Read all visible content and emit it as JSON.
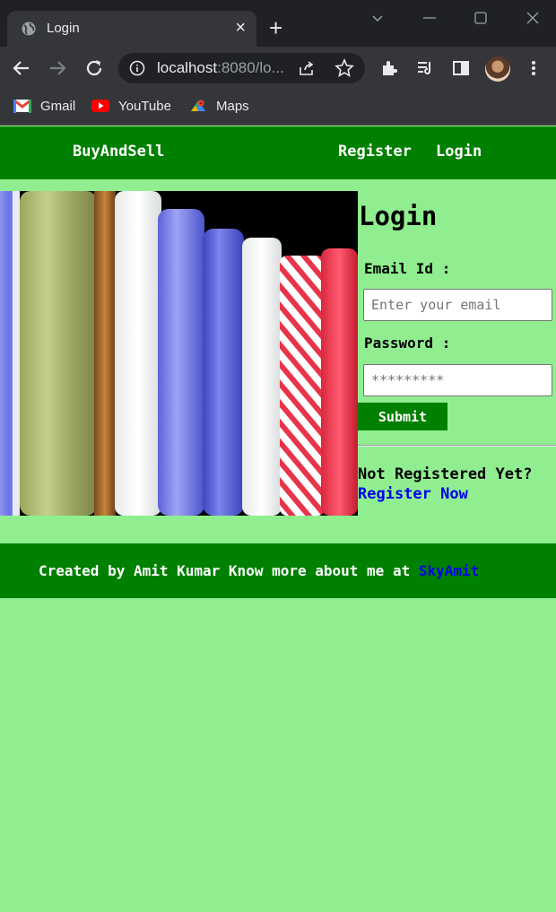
{
  "browser": {
    "tab_title": "Login",
    "tab_close": "×",
    "new_tab": "+",
    "url_host": "localhost",
    "url_rest": ":8080/lo...",
    "bookmarks": [
      {
        "label": "Gmail",
        "icon": "gmail-icon"
      },
      {
        "label": "YouTube",
        "icon": "youtube-icon"
      },
      {
        "label": "Maps",
        "icon": "maps-icon"
      }
    ]
  },
  "header": {
    "brand": "BuyAndSell",
    "nav": [
      "Register",
      "Login"
    ]
  },
  "login": {
    "title": "Login",
    "email_label": "Email Id :",
    "email_placeholder": "Enter your email",
    "password_label": "Password :",
    "password_placeholder": "*********",
    "submit_label": "Submit",
    "not_registered": "Not Registered Yet?",
    "register_link": "Register Now"
  },
  "footer": {
    "text": "Created by Amit Kumar Know more about me at",
    "link": "SkyAmit"
  },
  "colors": {
    "page_bg": "#90ee90",
    "header_bg": "#008000",
    "link": "#0000ee"
  }
}
